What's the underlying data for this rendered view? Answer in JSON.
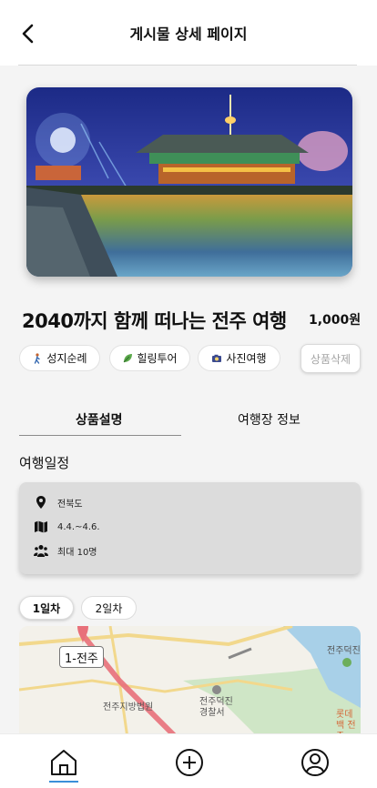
{
  "header": {
    "title": "게시물 상세 페이지"
  },
  "post": {
    "title": "2040까지 함께 떠나는 전주 여행",
    "price": "1,000원"
  },
  "tags": [
    {
      "label": "성지순례",
      "icon": "walking-person-icon"
    },
    {
      "label": "힐링투어",
      "icon": "leaf-icon"
    },
    {
      "label": "사진여행",
      "icon": "camera-icon"
    }
  ],
  "delete_label": "상품삭제",
  "tabs": [
    {
      "label": "상품설명"
    },
    {
      "label": "여행장 정보"
    }
  ],
  "itinerary": {
    "title": "여행일정",
    "location": "전북도",
    "dates": "4.4.~4.6.",
    "capacity": "최대 10명"
  },
  "days": [
    {
      "label": "1일차"
    },
    {
      "label": "2일차"
    }
  ],
  "map": {
    "marker_label": "1-전주",
    "places": [
      "전주지방법원",
      "전주덕진 경찰서",
      "전주덕진",
      "롯데백 전주"
    ]
  },
  "colors": {
    "accent": "#3a8fd9",
    "route": "#e8707a"
  }
}
